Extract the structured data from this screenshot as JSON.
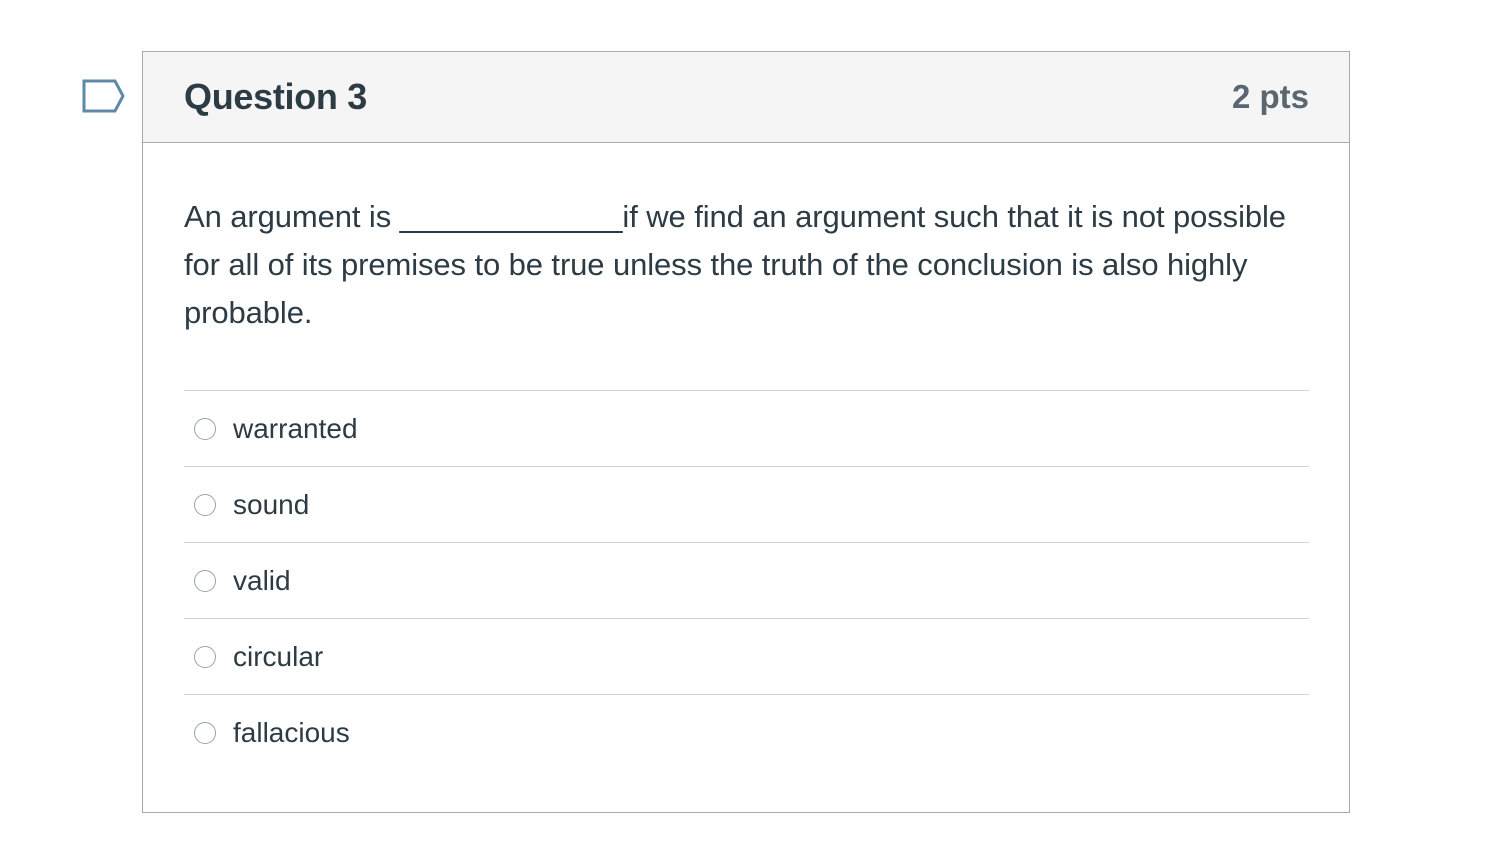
{
  "question": {
    "title": "Question 3",
    "points": "2 pts",
    "text": "An argument is _____________if we find an argument such that it is not possible for all of its premises to be true unless the truth of the conclusion is also highly probable.",
    "flag_icon": "bookmark-flag-icon"
  },
  "answers": [
    {
      "label": "warranted"
    },
    {
      "label": "sound"
    },
    {
      "label": "valid"
    },
    {
      "label": "circular"
    },
    {
      "label": "fallacious"
    }
  ],
  "colors": {
    "text": "#2d3b45",
    "points": "#5b6670",
    "header_bg": "#f5f5f5",
    "border": "#a8a8a8",
    "flag": "#5d8aa8"
  }
}
